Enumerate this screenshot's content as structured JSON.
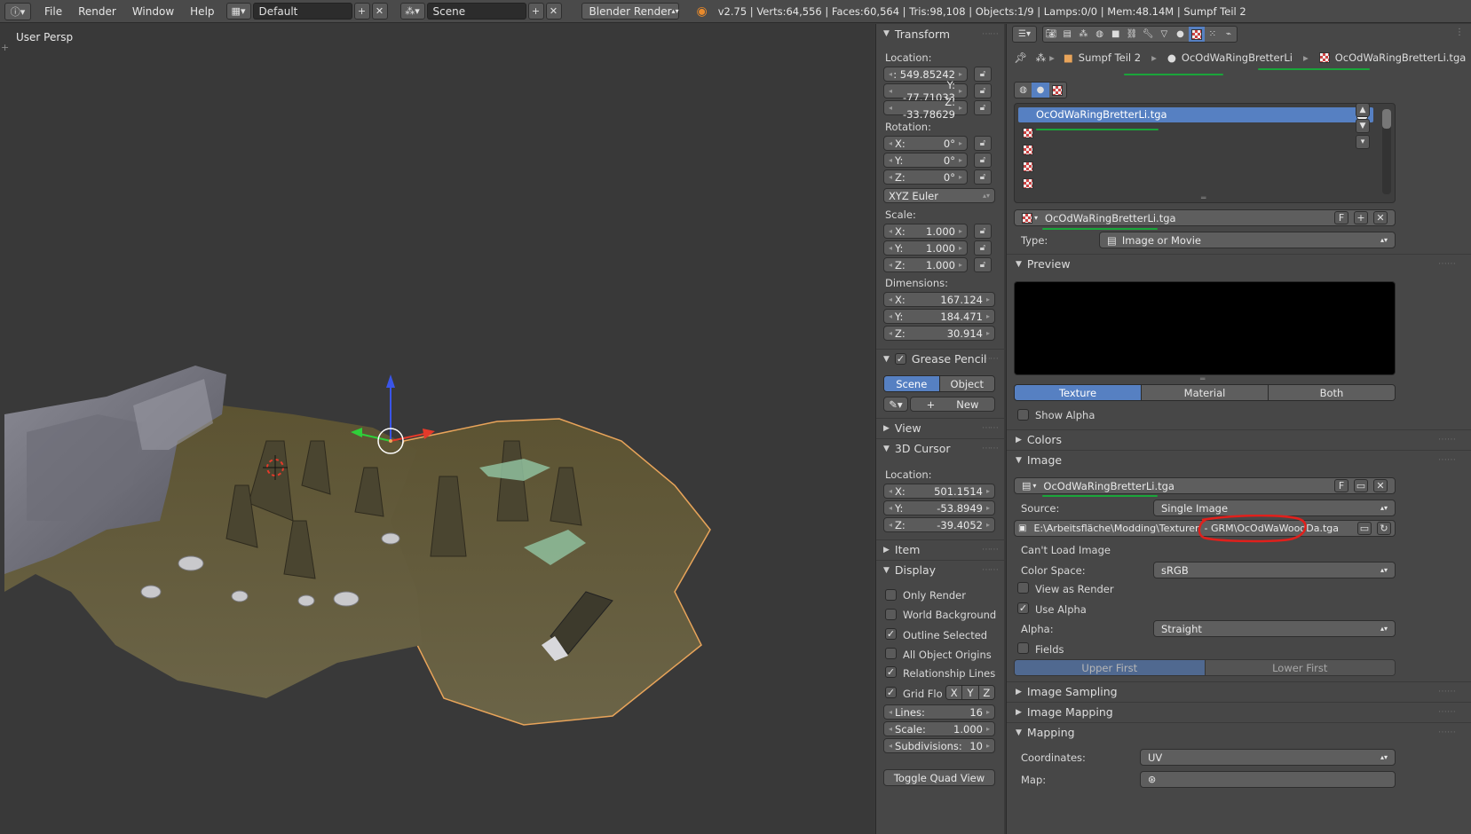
{
  "topbar": {
    "menus": [
      "File",
      "Render",
      "Window",
      "Help"
    ],
    "layout": "Default",
    "scene": "Scene",
    "engine": "Blender Render",
    "stats": "v2.75 | Verts:64,556 | Faces:60,564 | Tris:98,108 | Objects:1/9 | Lamps:0/0 | Mem:48.14M | Sumpf Teil 2"
  },
  "viewport": {
    "label": "User Persp"
  },
  "npanel": {
    "transform": {
      "title": "Transform",
      "location_label": "Location:",
      "loc": [
        ": 549.85242",
        "Y: -77.71033",
        "Z: -33.78629"
      ],
      "rotation_label": "Rotation:",
      "rot": [
        {
          "k": "X:",
          "v": "0°"
        },
        {
          "k": "Y:",
          "v": "0°"
        },
        {
          "k": "Z:",
          "v": "0°"
        }
      ],
      "rotation_mode": "XYZ Euler",
      "scale_label": "Scale:",
      "scale": [
        {
          "k": "X:",
          "v": "1.000"
        },
        {
          "k": "Y:",
          "v": "1.000"
        },
        {
          "k": "Z:",
          "v": "1.000"
        }
      ],
      "dimensions_label": "Dimensions:",
      "dim": [
        {
          "k": "X:",
          "v": "167.124"
        },
        {
          "k": "Y:",
          "v": "184.471"
        },
        {
          "k": "Z:",
          "v": "30.914"
        }
      ]
    },
    "grease": {
      "title": "Grease Pencil",
      "scene": "Scene",
      "object": "Object",
      "new": "New"
    },
    "view": {
      "title": "View"
    },
    "cursor": {
      "title": "3D Cursor",
      "location_label": "Location:",
      "loc": [
        {
          "k": "X:",
          "v": "501.1514"
        },
        {
          "k": "Y:",
          "v": "-53.8949"
        },
        {
          "k": "Z:",
          "v": "-39.4052"
        }
      ]
    },
    "item": {
      "title": "Item"
    },
    "display": {
      "title": "Display",
      "checks": [
        {
          "label": "Only Render",
          "checked": false
        },
        {
          "label": "World Background",
          "checked": false
        },
        {
          "label": "Outline Selected",
          "checked": true
        },
        {
          "label": "All Object Origins",
          "checked": false
        },
        {
          "label": "Relationship Lines",
          "checked": true
        }
      ],
      "gridflo": "Grid Flo",
      "axes": [
        "X",
        "Y",
        "Z"
      ],
      "grid": [
        {
          "k": "Lines:",
          "v": "16"
        },
        {
          "k": "Scale:",
          "v": "1.000"
        },
        {
          "k": "Subdivisions:",
          "v": "10"
        }
      ],
      "toggle_quad": "Toggle Quad View"
    }
  },
  "props": {
    "breadcrumb": [
      "Sumpf Teil 2",
      "OcOdWaRingBretterLi",
      "OcOdWaRingBretterLi.tga"
    ],
    "slots": {
      "selected": "OcOdWaRingBretterLi.tga",
      "count": 5
    },
    "texture_name": "OcOdWaRingBretterLi.tga",
    "f_label": "F",
    "type_label": "Type:",
    "type_value": "Image or Movie",
    "preview": {
      "title": "Preview",
      "tabs": [
        "Texture",
        "Material",
        "Both"
      ],
      "show_alpha": "Show Alpha"
    },
    "colors": {
      "title": "Colors"
    },
    "image": {
      "title": "Image",
      "name": "OcOdWaRingBretterLi.tga",
      "source_label": "Source:",
      "source": "Single Image",
      "path_prefix": "E:\\Arbeitsfläche\\Modding\\Texturen - GRM\\",
      "path_file": "OcOdWaWoodDa.tga",
      "cant_load": "Can't Load Image",
      "colorspace_label": "Color Space:",
      "colorspace": "sRGB",
      "view_as_render": "View as Render",
      "use_alpha": "Use Alpha",
      "alpha_label": "Alpha:",
      "alpha": "Straight",
      "fields": "Fields",
      "upper_first": "Upper First",
      "lower_first": "Lower First"
    },
    "image_sampling": {
      "title": "Image Sampling"
    },
    "image_mapping": {
      "title": "Image Mapping"
    },
    "mapping": {
      "title": "Mapping",
      "coords_label": "Coordinates:",
      "coords": "UV",
      "map_label": "Map:"
    }
  },
  "colors": {
    "accent": "#5680c2",
    "annotation_green": "#1aa53a",
    "annotation_red": "#e0201c",
    "outline": "#e8a45a"
  }
}
